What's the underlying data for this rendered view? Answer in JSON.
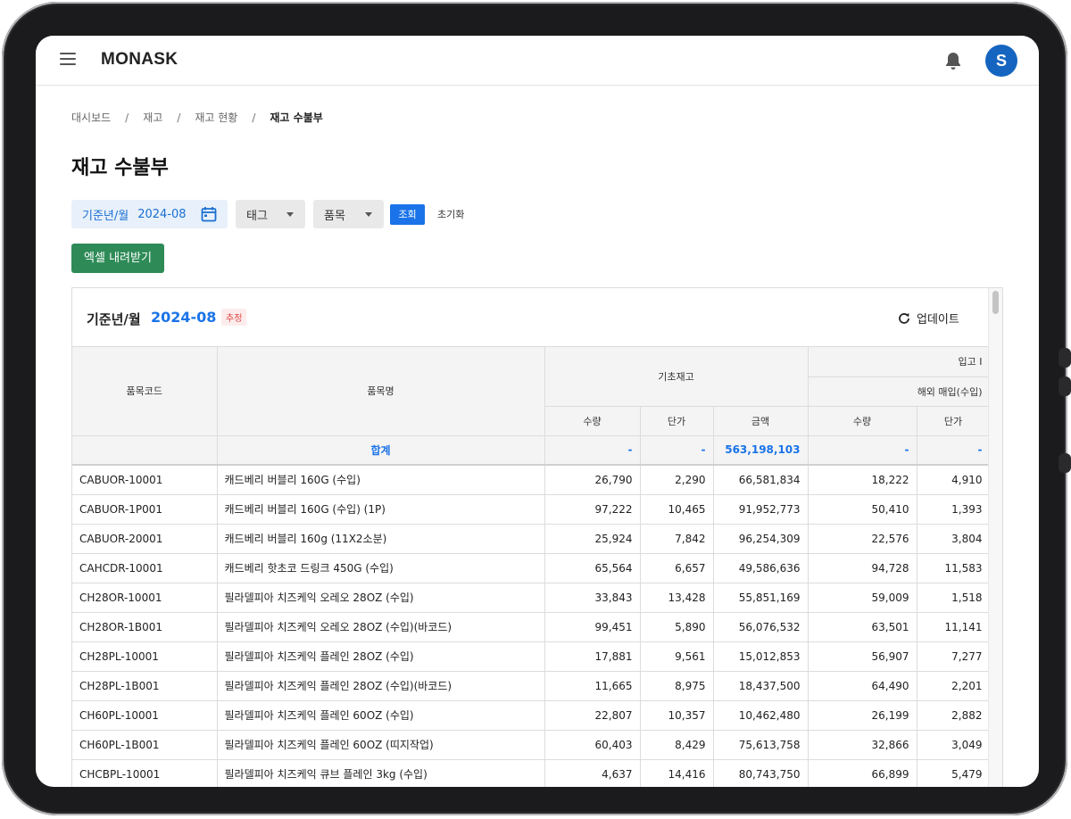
{
  "app": {
    "brand": "MONASK",
    "avatar_initial": "S"
  },
  "breadcrumb": [
    "대시보드",
    "재고",
    "재고 현황",
    "재고 수불부"
  ],
  "page_title": "재고 수불부",
  "filters": {
    "date_label": "기준년/월",
    "date_value": "2024-08",
    "tag_label": "태그",
    "item_label": "품목",
    "search_label": "조회",
    "reset_label": "초기화",
    "excel_label": "엑셀 내려받기"
  },
  "card": {
    "period_label": "기준년/월",
    "period_value": "2024-08",
    "badge": "추정",
    "update_label": "업데이트"
  },
  "table": {
    "headers": {
      "code": "품목코드",
      "name": "품목명",
      "opening": "기초재고",
      "inbound": "입고 I",
      "inbound_sub": "해외 매입(수입)",
      "qty": "수량",
      "unit_price": "단가",
      "amount": "금액"
    },
    "total": {
      "label": "합계",
      "opening_qty": "-",
      "opening_price": "-",
      "opening_amount": "563,198,103",
      "in_qty": "-",
      "in_price": "-"
    },
    "rows": [
      {
        "code": "CABUOR-10001",
        "name": "캐드베리 버블리 160G (수입)",
        "qty": "26,790",
        "price": "2,290",
        "amount": "66,581,834",
        "in_qty": "18,222",
        "in_price": "4,910"
      },
      {
        "code": "CABUOR-1P001",
        "name": "캐드베리 버블리 160G (수입) (1P)",
        "qty": "97,222",
        "price": "10,465",
        "amount": "91,952,773",
        "in_qty": "50,410",
        "in_price": "1,393"
      },
      {
        "code": "CABUOR-20001",
        "name": "캐드베리 버블리 160g (11X2소분)",
        "qty": "25,924",
        "price": "7,842",
        "amount": "96,254,309",
        "in_qty": "22,576",
        "in_price": "3,804"
      },
      {
        "code": "CAHCDR-10001",
        "name": "캐드베리 핫초코 드링크 450G (수입)",
        "qty": "65,564",
        "price": "6,657",
        "amount": "49,586,636",
        "in_qty": "94,728",
        "in_price": "11,583"
      },
      {
        "code": "CH28OR-10001",
        "name": "필라델피아 치즈케익 오레오 28OZ (수입)",
        "qty": "33,843",
        "price": "13,428",
        "amount": "55,851,169",
        "in_qty": "59,009",
        "in_price": "1,518"
      },
      {
        "code": "CH28OR-1B001",
        "name": "필라델피아 치즈케익 오레오 28OZ (수입)(바코드)",
        "qty": "99,451",
        "price": "5,890",
        "amount": "56,076,532",
        "in_qty": "63,501",
        "in_price": "11,141"
      },
      {
        "code": "CH28PL-10001",
        "name": "필라델피아 치즈케익 플레인 28OZ (수입)",
        "qty": "17,881",
        "price": "9,561",
        "amount": "15,012,853",
        "in_qty": "56,907",
        "in_price": "7,277"
      },
      {
        "code": "CH28PL-1B001",
        "name": "필라델피아 치즈케익 플레인 28OZ (수입)(바코드)",
        "qty": "11,665",
        "price": "8,975",
        "amount": "18,437,500",
        "in_qty": "64,490",
        "in_price": "2,201"
      },
      {
        "code": "CH60PL-10001",
        "name": "필라델피아 치즈케익 플레인 60OZ (수입)",
        "qty": "22,807",
        "price": "10,357",
        "amount": "10,462,480",
        "in_qty": "26,199",
        "in_price": "2,882"
      },
      {
        "code": "CH60PL-1B001",
        "name": "필라델피아 치즈케익 플레인 60OZ (띠지작업)",
        "qty": "60,403",
        "price": "8,429",
        "amount": "75,613,758",
        "in_qty": "32,866",
        "in_price": "3,049"
      },
      {
        "code": "CHCBPL-10001",
        "name": "필라델피아 치즈케익 큐브 플레인 3kg (수입)",
        "qty": "4,637",
        "price": "14,416",
        "amount": "80,743,750",
        "in_qty": "66,899",
        "in_price": "5,479"
      }
    ]
  }
}
